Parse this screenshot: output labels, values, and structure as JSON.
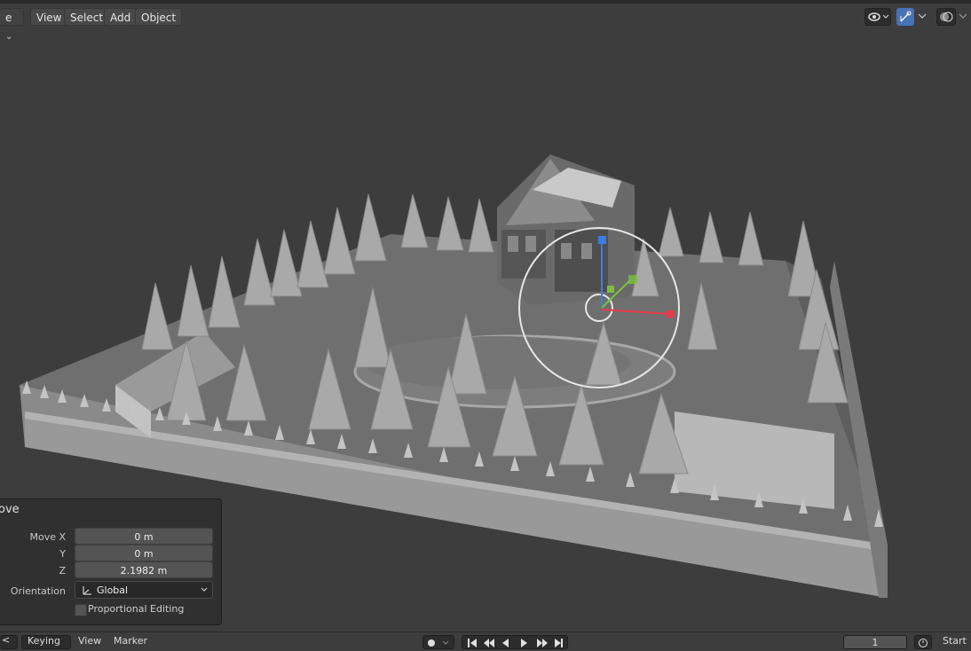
{
  "header": {
    "mode_fragment": "e",
    "menus": [
      "View",
      "Select",
      "Add",
      "Object"
    ]
  },
  "header_right_icons": [
    "visibility-eye-icon",
    "gizmo-toggle-icon",
    "overlay-icon"
  ],
  "operator_panel": {
    "title": "Move",
    "title_visible": "ove",
    "fields": [
      {
        "label": "Move X",
        "value": "0 m"
      },
      {
        "label": "Y",
        "value": "0 m"
      },
      {
        "label": "Z",
        "value": "2.1982 m"
      }
    ],
    "orientation_label": "Orientation",
    "orientation_value": "Global",
    "proportional_label": "Proportional Editing"
  },
  "timeline": {
    "fragment": "<",
    "keying": "Keying",
    "view": "View",
    "marker": "Marker",
    "current_frame": "1",
    "start": "Start"
  },
  "colors": {
    "gizmo_x": "#e83a4a",
    "gizmo_y": "#7cbf3e",
    "gizmo_z": "#3b7de8",
    "active_toggle": "#4772b3"
  }
}
